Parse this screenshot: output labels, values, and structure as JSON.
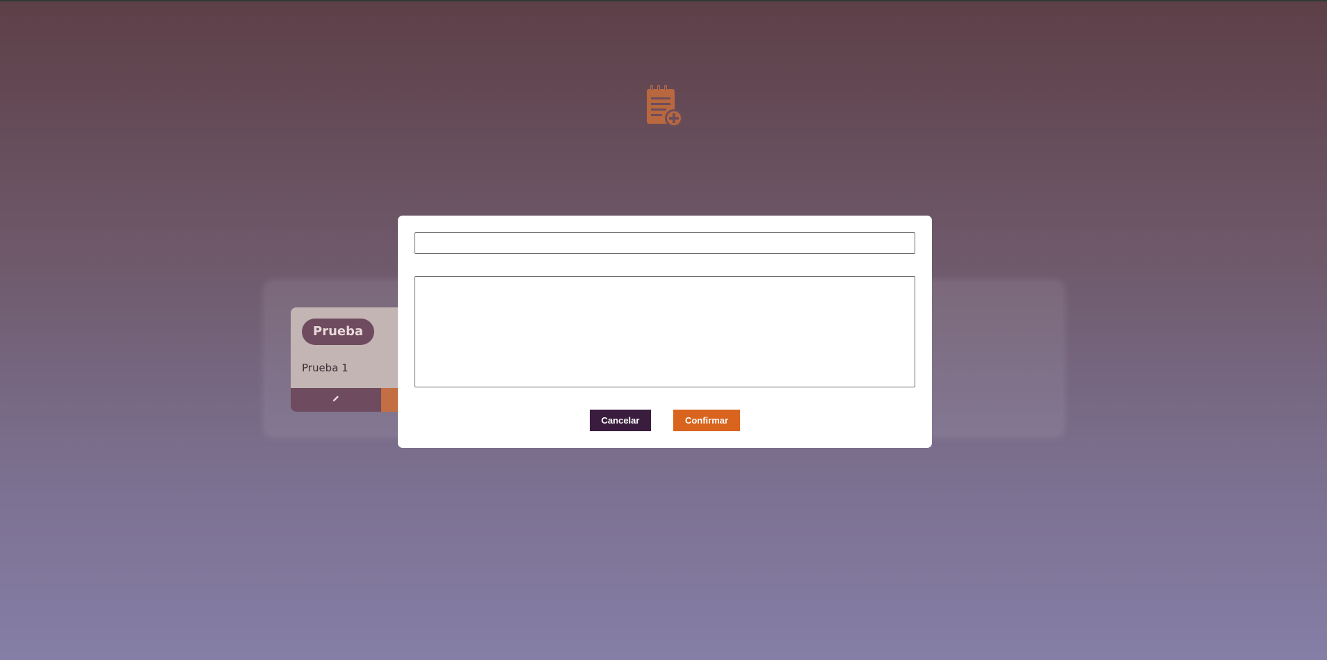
{
  "colors": {
    "accent_orange": "#d9641e",
    "dark_purple": "#3a1d3e",
    "card_background": "#c3b5b4",
    "pill_background": "#6e4b5e",
    "icon_color": "#b8673f"
  },
  "header": {
    "add_note_icon": "notepad-plus-icon"
  },
  "notes": [
    {
      "title": "Prueba",
      "body": "Prueba 1",
      "edit_icon": "pencil-icon"
    }
  ],
  "modal": {
    "title_value": "",
    "body_value": "",
    "cancel_label": "Cancelar",
    "confirm_label": "Confirmar"
  }
}
